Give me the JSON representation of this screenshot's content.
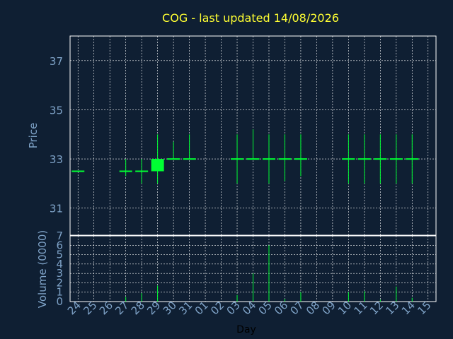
{
  "chart_data": [
    {
      "type": "candlestick",
      "title": "COG - last updated 14/08/2026",
      "ylabel": "Price",
      "ylim": [
        29.9,
        38.0
      ],
      "yticks": [
        31,
        33,
        35,
        37
      ],
      "grid": true,
      "colors": {
        "up": "#00ff33",
        "down": "#00ff33",
        "grid": "#ffffff",
        "text": "#7fa3c8",
        "title": "#ffff33"
      },
      "x": [
        "24",
        "25",
        "26",
        "27",
        "28",
        "29",
        "30",
        "31",
        "01",
        "02",
        "03",
        "04",
        "05",
        "06",
        "07",
        "08",
        "09",
        "10",
        "11",
        "12",
        "13",
        "14",
        "15"
      ],
      "candles": [
        {
          "x": "24",
          "open": 32.5,
          "high": 32.5,
          "low": 32.5,
          "close": 32.5
        },
        {
          "x": "27",
          "open": 32.5,
          "high": 33.0,
          "low": 32.3,
          "close": 32.5
        },
        {
          "x": "28",
          "open": 32.5,
          "high": 33.0,
          "low": 32.0,
          "close": 32.5
        },
        {
          "x": "29",
          "open": 32.5,
          "high": 34.0,
          "low": 32.0,
          "close": 33.0
        },
        {
          "x": "30",
          "open": 33.0,
          "high": 33.7,
          "low": 33.0,
          "close": 33.0
        },
        {
          "x": "31",
          "open": 33.0,
          "high": 34.0,
          "low": 33.0,
          "close": 33.0
        },
        {
          "x": "03",
          "open": 33.0,
          "high": 34.0,
          "low": 32.0,
          "close": 33.0
        },
        {
          "x": "04",
          "open": 33.0,
          "high": 34.2,
          "low": 33.0,
          "close": 33.0
        },
        {
          "x": "05",
          "open": 33.0,
          "high": 34.0,
          "low": 32.0,
          "close": 33.0
        },
        {
          "x": "06",
          "open": 33.0,
          "high": 34.0,
          "low": 32.1,
          "close": 33.0
        },
        {
          "x": "07",
          "open": 33.0,
          "high": 34.0,
          "low": 32.3,
          "close": 33.0
        },
        {
          "x": "10",
          "open": 33.0,
          "high": 34.0,
          "low": 32.0,
          "close": 33.0
        },
        {
          "x": "11",
          "open": 33.0,
          "high": 34.0,
          "low": 32.0,
          "close": 33.0
        },
        {
          "x": "12",
          "open": 33.0,
          "high": 34.0,
          "low": 32.0,
          "close": 33.0
        },
        {
          "x": "13",
          "open": 33.0,
          "high": 34.0,
          "low": 32.0,
          "close": 33.0
        },
        {
          "x": "14",
          "open": 33.0,
          "high": 34.0,
          "low": 32.0,
          "close": 33.0
        }
      ]
    },
    {
      "type": "bar",
      "ylabel": "Volume (0000)",
      "xlabel": "Day",
      "ylim": [
        0,
        7
      ],
      "yticks": [
        0,
        1,
        2,
        3,
        4,
        5,
        6,
        7
      ],
      "grid": true,
      "categories": [
        "24",
        "25",
        "26",
        "27",
        "28",
        "29",
        "30",
        "31",
        "01",
        "02",
        "03",
        "04",
        "05",
        "06",
        "07",
        "08",
        "09",
        "10",
        "11",
        "12",
        "13",
        "14",
        "15"
      ],
      "values": [
        0,
        0,
        0,
        0.5,
        0.9,
        1.7,
        0,
        0,
        0,
        0,
        0.7,
        3.0,
        6.0,
        0.3,
        1.0,
        0,
        0,
        1.0,
        1.1,
        0.2,
        1.6,
        0.4,
        0
      ]
    }
  ]
}
